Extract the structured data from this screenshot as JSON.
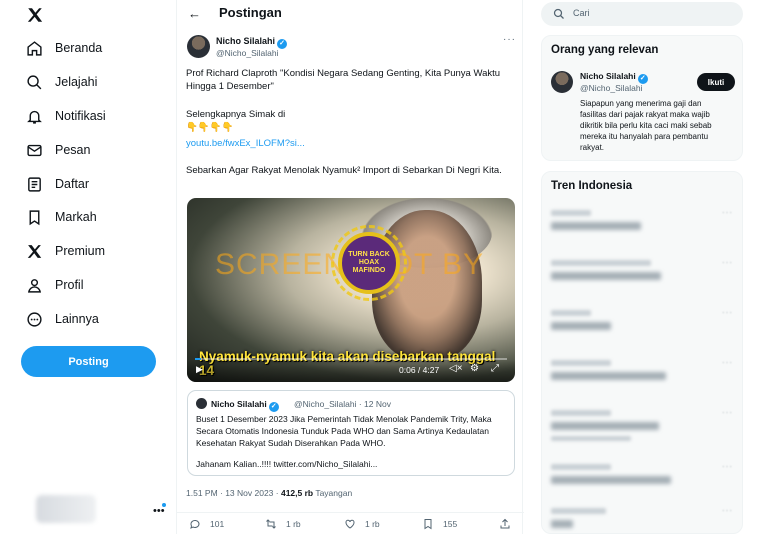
{
  "sidebar": {
    "items": [
      {
        "label": "Beranda",
        "icon": "home-icon"
      },
      {
        "label": "Jelajahi",
        "icon": "search-icon"
      },
      {
        "label": "Notifikasi",
        "icon": "bell-icon"
      },
      {
        "label": "Pesan",
        "icon": "mail-icon"
      },
      {
        "label": "Daftar",
        "icon": "list-icon"
      },
      {
        "label": "Markah",
        "icon": "bookmark-icon"
      },
      {
        "label": "Premium",
        "icon": "x-logo-icon"
      },
      {
        "label": "Profil",
        "icon": "person-icon"
      },
      {
        "label": "Lainnya",
        "icon": "more-circle-icon"
      }
    ],
    "post_button": "Posting",
    "account_dots": "•••"
  },
  "header": {
    "title": "Postingan",
    "back_icon": "←"
  },
  "post": {
    "author_name": "Nicho Silalahi",
    "author_handle": "@Nicho_Silalahi",
    "more": "···",
    "text1": "Prof Richard Claproth \"Kondisi Negara Sedang Genting, Kita Punya Waktu Hingga 1 Desember\"",
    "text2": "Selengkapnya Simak di",
    "emojis": "👇👇👇👇",
    "link": "youtu.be/fwxEx_ILOFM?si...",
    "text3": "Sebarkan Agar Rakyat Menolak Nyamuk² Import di Sebarkan Di Negri Kita.",
    "video": {
      "watermark": "SCREENSHOT BY",
      "seal_text": "TURN BACK HOAX",
      "seal_org": "MAFINDO",
      "subtitle": "Nyamuk-nyamuk kita akan disebarkan tanggal 14",
      "time": "0:06 / 4:27",
      "progress": 0.02
    },
    "quote": {
      "name": "Nicho Silalahi",
      "meta": "@Nicho_Silalahi · 12 Nov",
      "text": "Buset 1 Desember 2023 Jika Pemerintah Tidak Menolak Pandemik Trity, Maka Secara Otomatis Indonesia Tunduk Pada WHO dan Sama Artinya Kedaulatan Kesehatan Rakyat Sudah Diserahkan Pada WHO.",
      "text2": "Jahanam Kalian..!!!! twitter.com/Nicho_Silalahi..."
    },
    "meta_time": "1.51 PM · 13 Nov 2023 · ",
    "meta_views": "412,5 rb",
    "meta_views_label": " Tayangan",
    "actions": {
      "replies": "101",
      "reposts": "1 rb",
      "likes": "1 rb",
      "bookmarks": "155"
    }
  },
  "right": {
    "search_placeholder": "Cari",
    "relevant_title": "Orang yang relevan",
    "relevant_name": "Nicho Silalahi",
    "relevant_handle": "@Nicho_Silalahi",
    "follow_label": "Ikuti",
    "relevant_bio": "Siapapun yang menerima gaji dan fasilitas dari pajak rakyat maka wajib dikritik bila perlu kita caci maki sebab mereka itu hanyalah para pembantu rakyat.",
    "trends_title": "Tren Indonesia"
  },
  "colors": {
    "accent": "#1d9bf0",
    "text": "#0f1419",
    "muted": "#536471"
  }
}
